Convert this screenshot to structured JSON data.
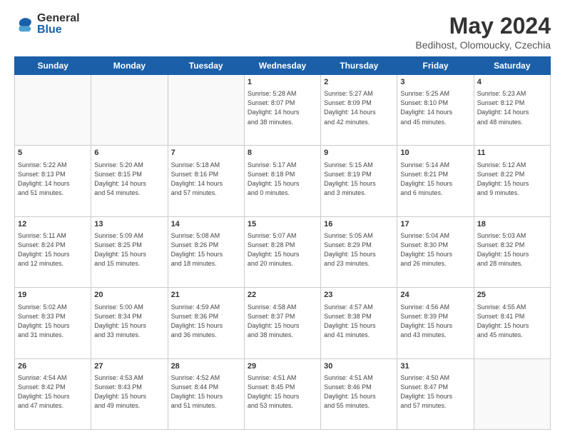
{
  "header": {
    "logo_general": "General",
    "logo_blue": "Blue",
    "title": "May 2024",
    "subtitle": "Bedihost, Olomoucky, Czechia"
  },
  "days_of_week": [
    "Sunday",
    "Monday",
    "Tuesday",
    "Wednesday",
    "Thursday",
    "Friday",
    "Saturday"
  ],
  "weeks": [
    [
      {
        "day": "",
        "info": ""
      },
      {
        "day": "",
        "info": ""
      },
      {
        "day": "",
        "info": ""
      },
      {
        "day": "1",
        "info": "Sunrise: 5:28 AM\nSunset: 8:07 PM\nDaylight: 14 hours\nand 38 minutes."
      },
      {
        "day": "2",
        "info": "Sunrise: 5:27 AM\nSunset: 8:09 PM\nDaylight: 14 hours\nand 42 minutes."
      },
      {
        "day": "3",
        "info": "Sunrise: 5:25 AM\nSunset: 8:10 PM\nDaylight: 14 hours\nand 45 minutes."
      },
      {
        "day": "4",
        "info": "Sunrise: 5:23 AM\nSunset: 8:12 PM\nDaylight: 14 hours\nand 48 minutes."
      }
    ],
    [
      {
        "day": "5",
        "info": "Sunrise: 5:22 AM\nSunset: 8:13 PM\nDaylight: 14 hours\nand 51 minutes."
      },
      {
        "day": "6",
        "info": "Sunrise: 5:20 AM\nSunset: 8:15 PM\nDaylight: 14 hours\nand 54 minutes."
      },
      {
        "day": "7",
        "info": "Sunrise: 5:18 AM\nSunset: 8:16 PM\nDaylight: 14 hours\nand 57 minutes."
      },
      {
        "day": "8",
        "info": "Sunrise: 5:17 AM\nSunset: 8:18 PM\nDaylight: 15 hours\nand 0 minutes."
      },
      {
        "day": "9",
        "info": "Sunrise: 5:15 AM\nSunset: 8:19 PM\nDaylight: 15 hours\nand 3 minutes."
      },
      {
        "day": "10",
        "info": "Sunrise: 5:14 AM\nSunset: 8:21 PM\nDaylight: 15 hours\nand 6 minutes."
      },
      {
        "day": "11",
        "info": "Sunrise: 5:12 AM\nSunset: 8:22 PM\nDaylight: 15 hours\nand 9 minutes."
      }
    ],
    [
      {
        "day": "12",
        "info": "Sunrise: 5:11 AM\nSunset: 8:24 PM\nDaylight: 15 hours\nand 12 minutes."
      },
      {
        "day": "13",
        "info": "Sunrise: 5:09 AM\nSunset: 8:25 PM\nDaylight: 15 hours\nand 15 minutes."
      },
      {
        "day": "14",
        "info": "Sunrise: 5:08 AM\nSunset: 8:26 PM\nDaylight: 15 hours\nand 18 minutes."
      },
      {
        "day": "15",
        "info": "Sunrise: 5:07 AM\nSunset: 8:28 PM\nDaylight: 15 hours\nand 20 minutes."
      },
      {
        "day": "16",
        "info": "Sunrise: 5:05 AM\nSunset: 8:29 PM\nDaylight: 15 hours\nand 23 minutes."
      },
      {
        "day": "17",
        "info": "Sunrise: 5:04 AM\nSunset: 8:30 PM\nDaylight: 15 hours\nand 26 minutes."
      },
      {
        "day": "18",
        "info": "Sunrise: 5:03 AM\nSunset: 8:32 PM\nDaylight: 15 hours\nand 28 minutes."
      }
    ],
    [
      {
        "day": "19",
        "info": "Sunrise: 5:02 AM\nSunset: 8:33 PM\nDaylight: 15 hours\nand 31 minutes."
      },
      {
        "day": "20",
        "info": "Sunrise: 5:00 AM\nSunset: 8:34 PM\nDaylight: 15 hours\nand 33 minutes."
      },
      {
        "day": "21",
        "info": "Sunrise: 4:59 AM\nSunset: 8:36 PM\nDaylight: 15 hours\nand 36 minutes."
      },
      {
        "day": "22",
        "info": "Sunrise: 4:58 AM\nSunset: 8:37 PM\nDaylight: 15 hours\nand 38 minutes."
      },
      {
        "day": "23",
        "info": "Sunrise: 4:57 AM\nSunset: 8:38 PM\nDaylight: 15 hours\nand 41 minutes."
      },
      {
        "day": "24",
        "info": "Sunrise: 4:56 AM\nSunset: 8:39 PM\nDaylight: 15 hours\nand 43 minutes."
      },
      {
        "day": "25",
        "info": "Sunrise: 4:55 AM\nSunset: 8:41 PM\nDaylight: 15 hours\nand 45 minutes."
      }
    ],
    [
      {
        "day": "26",
        "info": "Sunrise: 4:54 AM\nSunset: 8:42 PM\nDaylight: 15 hours\nand 47 minutes."
      },
      {
        "day": "27",
        "info": "Sunrise: 4:53 AM\nSunset: 8:43 PM\nDaylight: 15 hours\nand 49 minutes."
      },
      {
        "day": "28",
        "info": "Sunrise: 4:52 AM\nSunset: 8:44 PM\nDaylight: 15 hours\nand 51 minutes."
      },
      {
        "day": "29",
        "info": "Sunrise: 4:51 AM\nSunset: 8:45 PM\nDaylight: 15 hours\nand 53 minutes."
      },
      {
        "day": "30",
        "info": "Sunrise: 4:51 AM\nSunset: 8:46 PM\nDaylight: 15 hours\nand 55 minutes."
      },
      {
        "day": "31",
        "info": "Sunrise: 4:50 AM\nSunset: 8:47 PM\nDaylight: 15 hours\nand 57 minutes."
      },
      {
        "day": "",
        "info": ""
      }
    ]
  ]
}
